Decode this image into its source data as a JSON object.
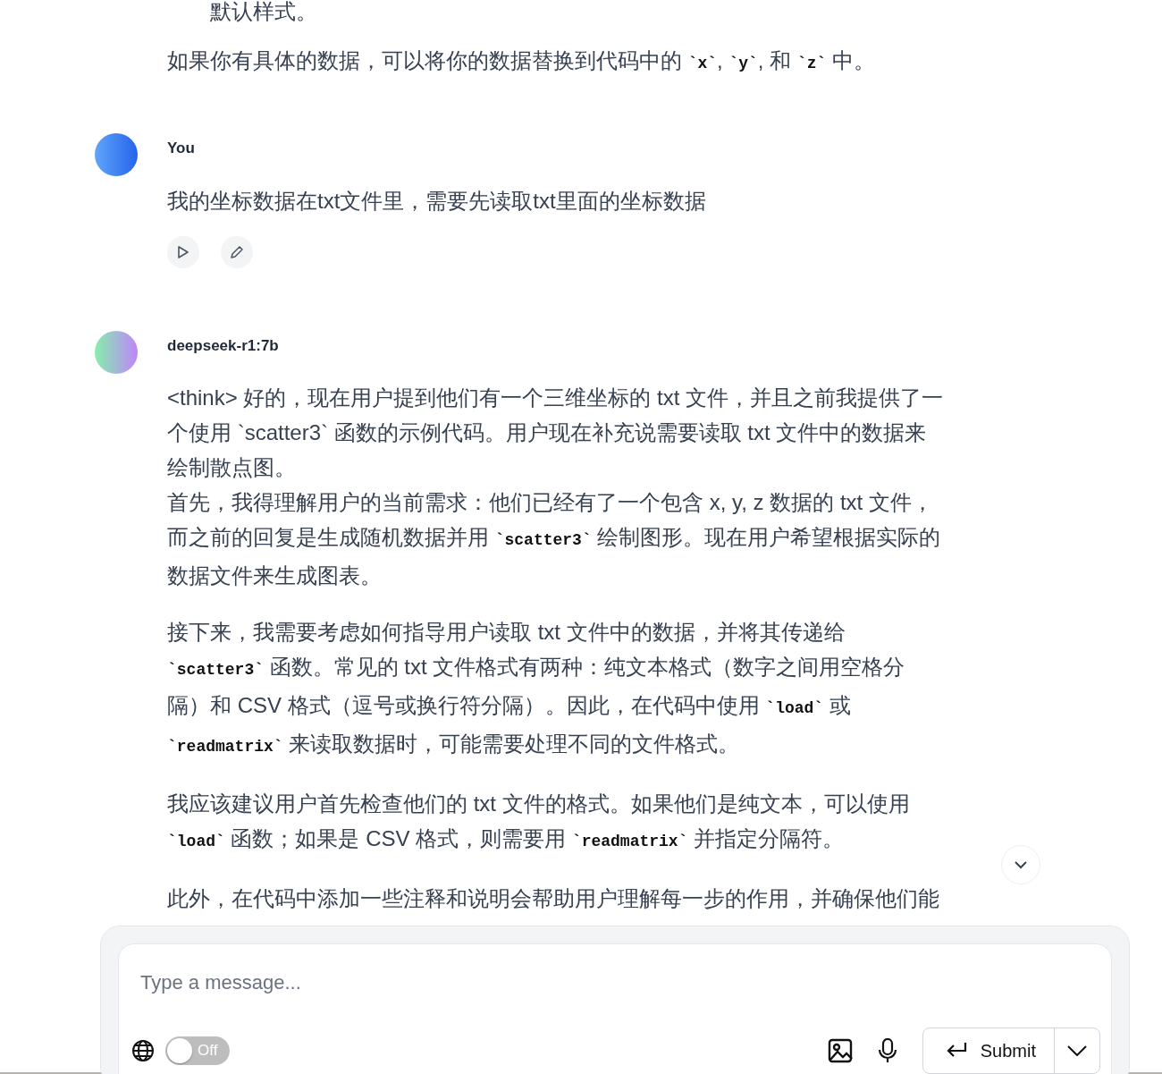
{
  "messages": [
    {
      "kind": "continuation",
      "paragraphs": [
        {
          "indent": true,
          "segments": [
            {
              "kind": "text",
              "text": "默认样式。"
            }
          ]
        },
        {
          "indent": false,
          "segments": [
            {
              "kind": "text",
              "text": "如果你有具体的数据，可以将你的数据替换到代码中的 "
            },
            {
              "kind": "code",
              "text": "`x`"
            },
            {
              "kind": "text",
              "text": ", "
            },
            {
              "kind": "code",
              "text": "`y`"
            },
            {
              "kind": "text",
              "text": ", 和 "
            },
            {
              "kind": "code",
              "text": "`z`"
            },
            {
              "kind": "text",
              "text": " 中。"
            }
          ]
        }
      ]
    },
    {
      "kind": "user",
      "author": "You",
      "paragraphs": [
        {
          "indent": false,
          "segments": [
            {
              "kind": "text",
              "text": "我的坐标数据在txt文件里，需要先读取txt里面的坐标数据"
            }
          ]
        }
      ],
      "actions": [
        {
          "kind": "play"
        },
        {
          "kind": "edit"
        }
      ]
    },
    {
      "kind": "assistant",
      "author": "deepseek-r1:7b",
      "paragraphs": [
        {
          "indent": false,
          "segments": [
            {
              "kind": "text",
              "text": "<think> 好的，现在用户提到他们有一个三维坐标的 txt 文件，并且之前我提供了一个使用 `scatter3` 函数的示例代码。用户现在补充说需要读取 txt 文件中的数据来绘制散点图。"
            },
            {
              "kind": "break"
            },
            {
              "kind": "text",
              "text": "首先，我得理解用户的当前需求：他们已经有了一个包含 x, y, z 数据的 txt 文件，而之前的回复是生成随机数据并用 "
            },
            {
              "kind": "code",
              "text": "`scatter3`"
            },
            {
              "kind": "text",
              "text": " 绘制图形。现在用户希望根据实际的数据文件来生成图表。"
            }
          ]
        },
        {
          "indent": false,
          "segments": [
            {
              "kind": "text",
              "text": "接下来，我需要考虑如何指导用户读取 txt 文件中的数据，并将其传递给 "
            },
            {
              "kind": "code",
              "text": "`scatter3`"
            },
            {
              "kind": "text",
              "text": " 函数。常见的 txt 文件格式有两种：纯文本格式（数字之间用空格分隔）和 CSV 格式（逗号或换行符分隔）。因此，在代码中使用 "
            },
            {
              "kind": "code",
              "text": "`load`"
            },
            {
              "kind": "text",
              "text": " 或 "
            },
            {
              "kind": "code",
              "text": "`readmatrix`"
            },
            {
              "kind": "text",
              "text": " 来读取数据时，可能需要处理不同的文件格式。"
            }
          ]
        },
        {
          "indent": false,
          "segments": [
            {
              "kind": "text",
              "text": "我应该建议用户首先检查他们的 txt 文件的格式。如果他们是纯文本，可以使用 "
            },
            {
              "kind": "code",
              "text": "`load`"
            },
            {
              "kind": "text",
              "text": " 函数；如果是 CSV 格式，则需要用 "
            },
            {
              "kind": "code",
              "text": "`readmatrix`"
            },
            {
              "kind": "text",
              "text": " 并指定分隔符。"
            }
          ]
        },
        {
          "indent": false,
          "segments": [
            {
              "kind": "text",
              "text": "此外，在代码中添加一些注释和说明会帮助用户理解每一步的作用，并确保他们能"
            }
          ]
        }
      ]
    }
  ],
  "composer": {
    "placeholder": "Type a message...",
    "search_toggle": {
      "label": "Off",
      "on": false
    },
    "submit": "Submit"
  }
}
